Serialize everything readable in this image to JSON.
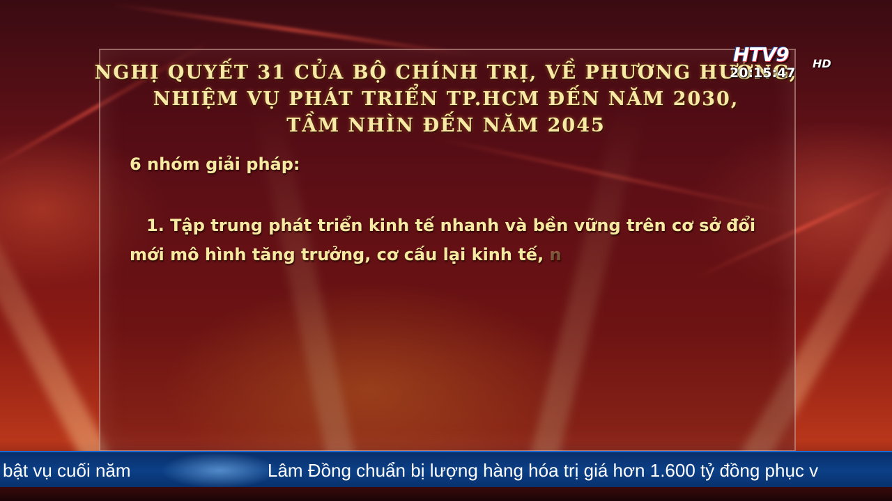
{
  "title": {
    "line1": "NGHỊ QUYẾT 31 CỦA BỘ CHÍNH TRỊ, VỀ PHƯƠNG HƯỚNG,",
    "line2": "NHIỆM VỤ PHÁT TRIỂN TP.HCM ĐẾN NĂM 2030,",
    "line3": "TẦM NHÌN ĐẾN NĂM 2045"
  },
  "subheading": "6 nhóm giải pháp:",
  "body": {
    "line1": "1. Tập trung phát triển kinh tế nhanh và bền vững trên cơ sở đổi",
    "line2": "mới mô hình tăng trưởng, cơ cấu lại kinh tế,",
    "line2_fading": " n"
  },
  "channel": {
    "logo": "HTV9",
    "hd": "HD",
    "clock": "20:15:47"
  },
  "ticker": {
    "item1": "bật vụ cuối năm",
    "item2": "Lâm Đồng chuẩn bị lượng hàng hóa trị giá hơn 1.600 tỷ đồng phục v"
  }
}
